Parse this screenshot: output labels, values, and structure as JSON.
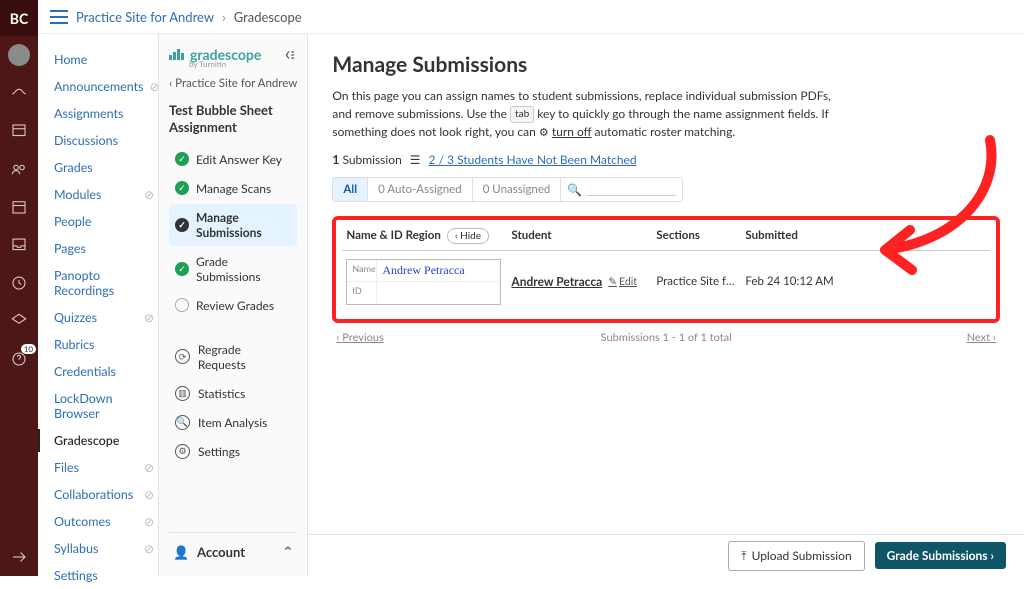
{
  "rail": {
    "logo": "BC",
    "badge_count": "10"
  },
  "crumbs": {
    "course": "Practice Site for Andrew",
    "sep": "›",
    "current": "Gradescope"
  },
  "coursenav": [
    {
      "label": "Home",
      "hidden": false
    },
    {
      "label": "Announcements",
      "hidden": true
    },
    {
      "label": "Assignments",
      "hidden": false
    },
    {
      "label": "Discussions",
      "hidden": false
    },
    {
      "label": "Grades",
      "hidden": false
    },
    {
      "label": "Modules",
      "hidden": true
    },
    {
      "label": "People",
      "hidden": false
    },
    {
      "label": "Pages",
      "hidden": false
    },
    {
      "label": "Panopto Recordings",
      "hidden": false
    },
    {
      "label": "Quizzes",
      "hidden": true
    },
    {
      "label": "Rubrics",
      "hidden": false
    },
    {
      "label": "Credentials",
      "hidden": false
    },
    {
      "label": "LockDown Browser",
      "hidden": false
    },
    {
      "label": "Gradescope",
      "hidden": false,
      "active": true
    },
    {
      "label": "Files",
      "hidden": true
    },
    {
      "label": "Collaborations",
      "hidden": true
    },
    {
      "label": "Outcomes",
      "hidden": true
    },
    {
      "label": "Syllabus",
      "hidden": true
    },
    {
      "label": "Settings",
      "hidden": false
    }
  ],
  "gs": {
    "brand": "gradescope",
    "brand_sub": "by Turnitin",
    "back": "‹ Practice Site for Andrew",
    "assignment_title": "Test Bubble Sheet Assignment",
    "steps": {
      "edit_answer_key": "Edit Answer Key",
      "manage_scans": "Manage Scans",
      "manage_submissions": "Manage Submissions",
      "grade_submissions": "Grade Submissions",
      "review_grades": "Review Grades"
    },
    "tools": {
      "regrade_requests": "Regrade Requests",
      "statistics": "Statistics",
      "item_analysis": "Item Analysis",
      "settings": "Settings"
    },
    "account": "Account"
  },
  "main": {
    "title": "Manage Submissions",
    "desc_1": "On this page you can assign names to student submissions, replace individual submission PDFs, and remove submissions. Use the ",
    "desc_key": "tab",
    "desc_2": " key to quickly go through the name assignment fields. If something does not look right, you can ",
    "desc_turnoff": "turn off",
    "desc_3": " automatic roster matching.",
    "sub_count_bold": "1",
    "sub_count_word": "Submission",
    "unmatched": "2 / 3 Students Have Not Been Matched",
    "filters": {
      "all": "All",
      "auto": "0 Auto-Assigned",
      "unassigned": "0 Unassigned"
    },
    "headers": {
      "name": "Name & ID Region",
      "hide": "‹ Hide",
      "student": "Student",
      "sections": "Sections",
      "submitted": "Submitted"
    },
    "row": {
      "name_lbl": "Name",
      "name_val": "Andrew Petracca",
      "id_lbl": "ID",
      "student": "Andrew Petracca",
      "edit": "Edit",
      "section": "Practice Site for Andr...",
      "submitted": "Feb 24 10:12 AM"
    },
    "pager": {
      "prev": "‹ Previous",
      "status": "Submissions 1 - 1 of 1 total",
      "next": "Next ›"
    },
    "footer": {
      "upload": "Upload Submission",
      "grade": "Grade Submissions ›"
    }
  }
}
